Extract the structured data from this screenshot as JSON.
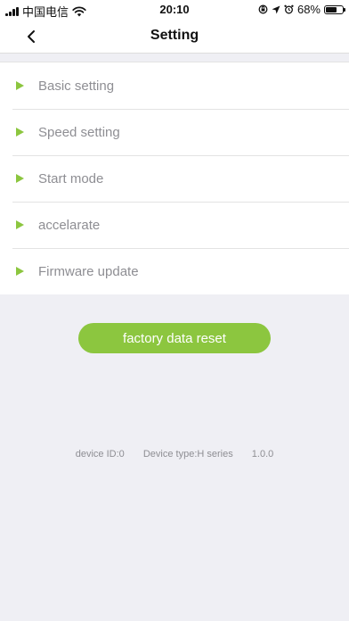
{
  "status_bar": {
    "carrier": "中国电信",
    "time": "20:10",
    "battery": "68%",
    "battery_level": 0.68,
    "icons": [
      "signal-icon",
      "wifi-icon",
      "rotation-lock-icon",
      "location-icon",
      "alarm-icon",
      "battery-icon"
    ]
  },
  "nav": {
    "title": "Setting",
    "back_icon": "chevron-left-icon"
  },
  "settings": {
    "items": [
      {
        "label": "Basic setting"
      },
      {
        "label": "Speed setting"
      },
      {
        "label": "Start mode"
      },
      {
        "label": "accelarate"
      },
      {
        "label": "Firmware update"
      }
    ]
  },
  "actions": {
    "factory_reset_label": "factory data reset"
  },
  "device": {
    "id": "device ID:0",
    "type": "Device type:H series",
    "version": "1.0.0"
  },
  "colors": {
    "accent": "#8cc63f",
    "background": "#efeff4",
    "label_gray": "#8e8e93"
  }
}
